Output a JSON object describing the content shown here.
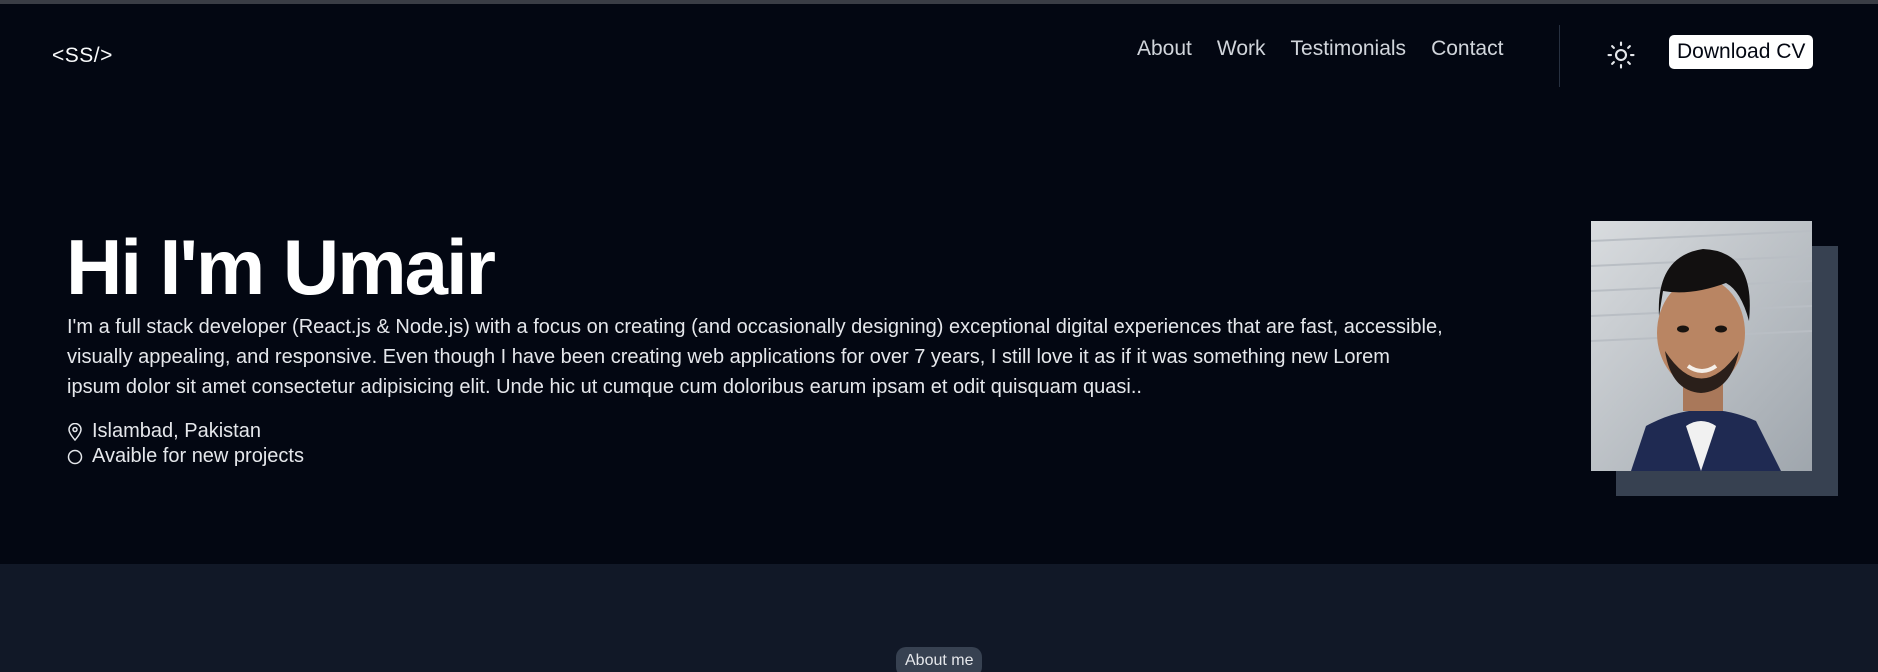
{
  "header": {
    "logo": "<SS/>",
    "nav": [
      {
        "label": "About"
      },
      {
        "label": "Work"
      },
      {
        "label": "Testimonials"
      },
      {
        "label": "Contact"
      }
    ],
    "theme_icon": "sun-icon",
    "cv_button": "Download CV"
  },
  "hero": {
    "title": "Hi I'm Umair",
    "description": "I'm a full stack developer (React.js & Node.js) with a focus on creating (and occasionally designing) exceptional digital experiences that are fast, accessible, visually appealing, and responsive. Even though I have been creating web applications for over 7 years, I still love it as if it was something new Lorem ipsum dolor sit amet consectetur adipisicing elit. Unde hic ut cumque cum doloribus earum ipsam et odit quisquam quasi..",
    "location_icon": "map-pin-icon",
    "location": "Islambad, Pakistan",
    "availability_icon": "circle-icon",
    "availability": "Avaible for new projects"
  },
  "about": {
    "badge": "About me"
  },
  "colors": {
    "background": "#030712",
    "section_background": "#111827",
    "photo_accent": "#374151",
    "button": "#ffffff"
  }
}
